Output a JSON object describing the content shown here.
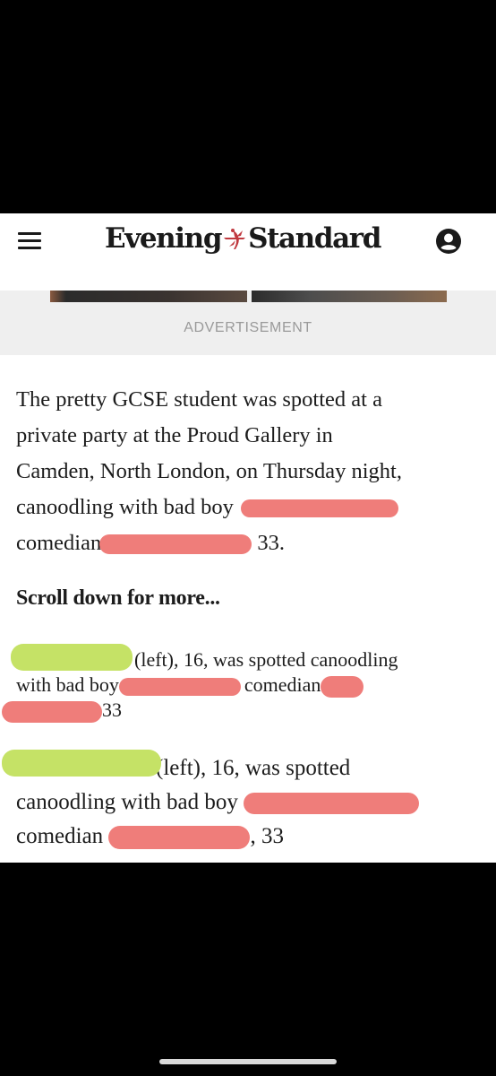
{
  "header": {
    "menu_icon": "hamburger-menu-icon",
    "logo_left": "Evening",
    "logo_right": "Standard",
    "user_icon": "user-account-icon"
  },
  "ad": {
    "label": "ADVERTISEMENT"
  },
  "article": {
    "paragraph_lines": [
      "The pretty GCSE student was spotted at a",
      "private party at the Proud Gallery in",
      "Camden, North London, on Thursday night,",
      "canoodling with bad boy",
      "comedian",
      "33."
    ],
    "scroll_more": "Scroll down for more...",
    "caption1": {
      "line1_text": "(left), 16, was spotted canoodling",
      "line2_a": "with bad boy",
      "line2_b": "comedian",
      "line3": "33"
    },
    "caption2": {
      "line1_text": "(left), 16, was spotted",
      "line2": "canoodling with bad boy",
      "line3_a": "comedian",
      "line3_b": ", 33"
    }
  },
  "colors": {
    "redaction_red": "#ef7d7a",
    "redaction_green": "#c5e266",
    "background": "#000000"
  }
}
